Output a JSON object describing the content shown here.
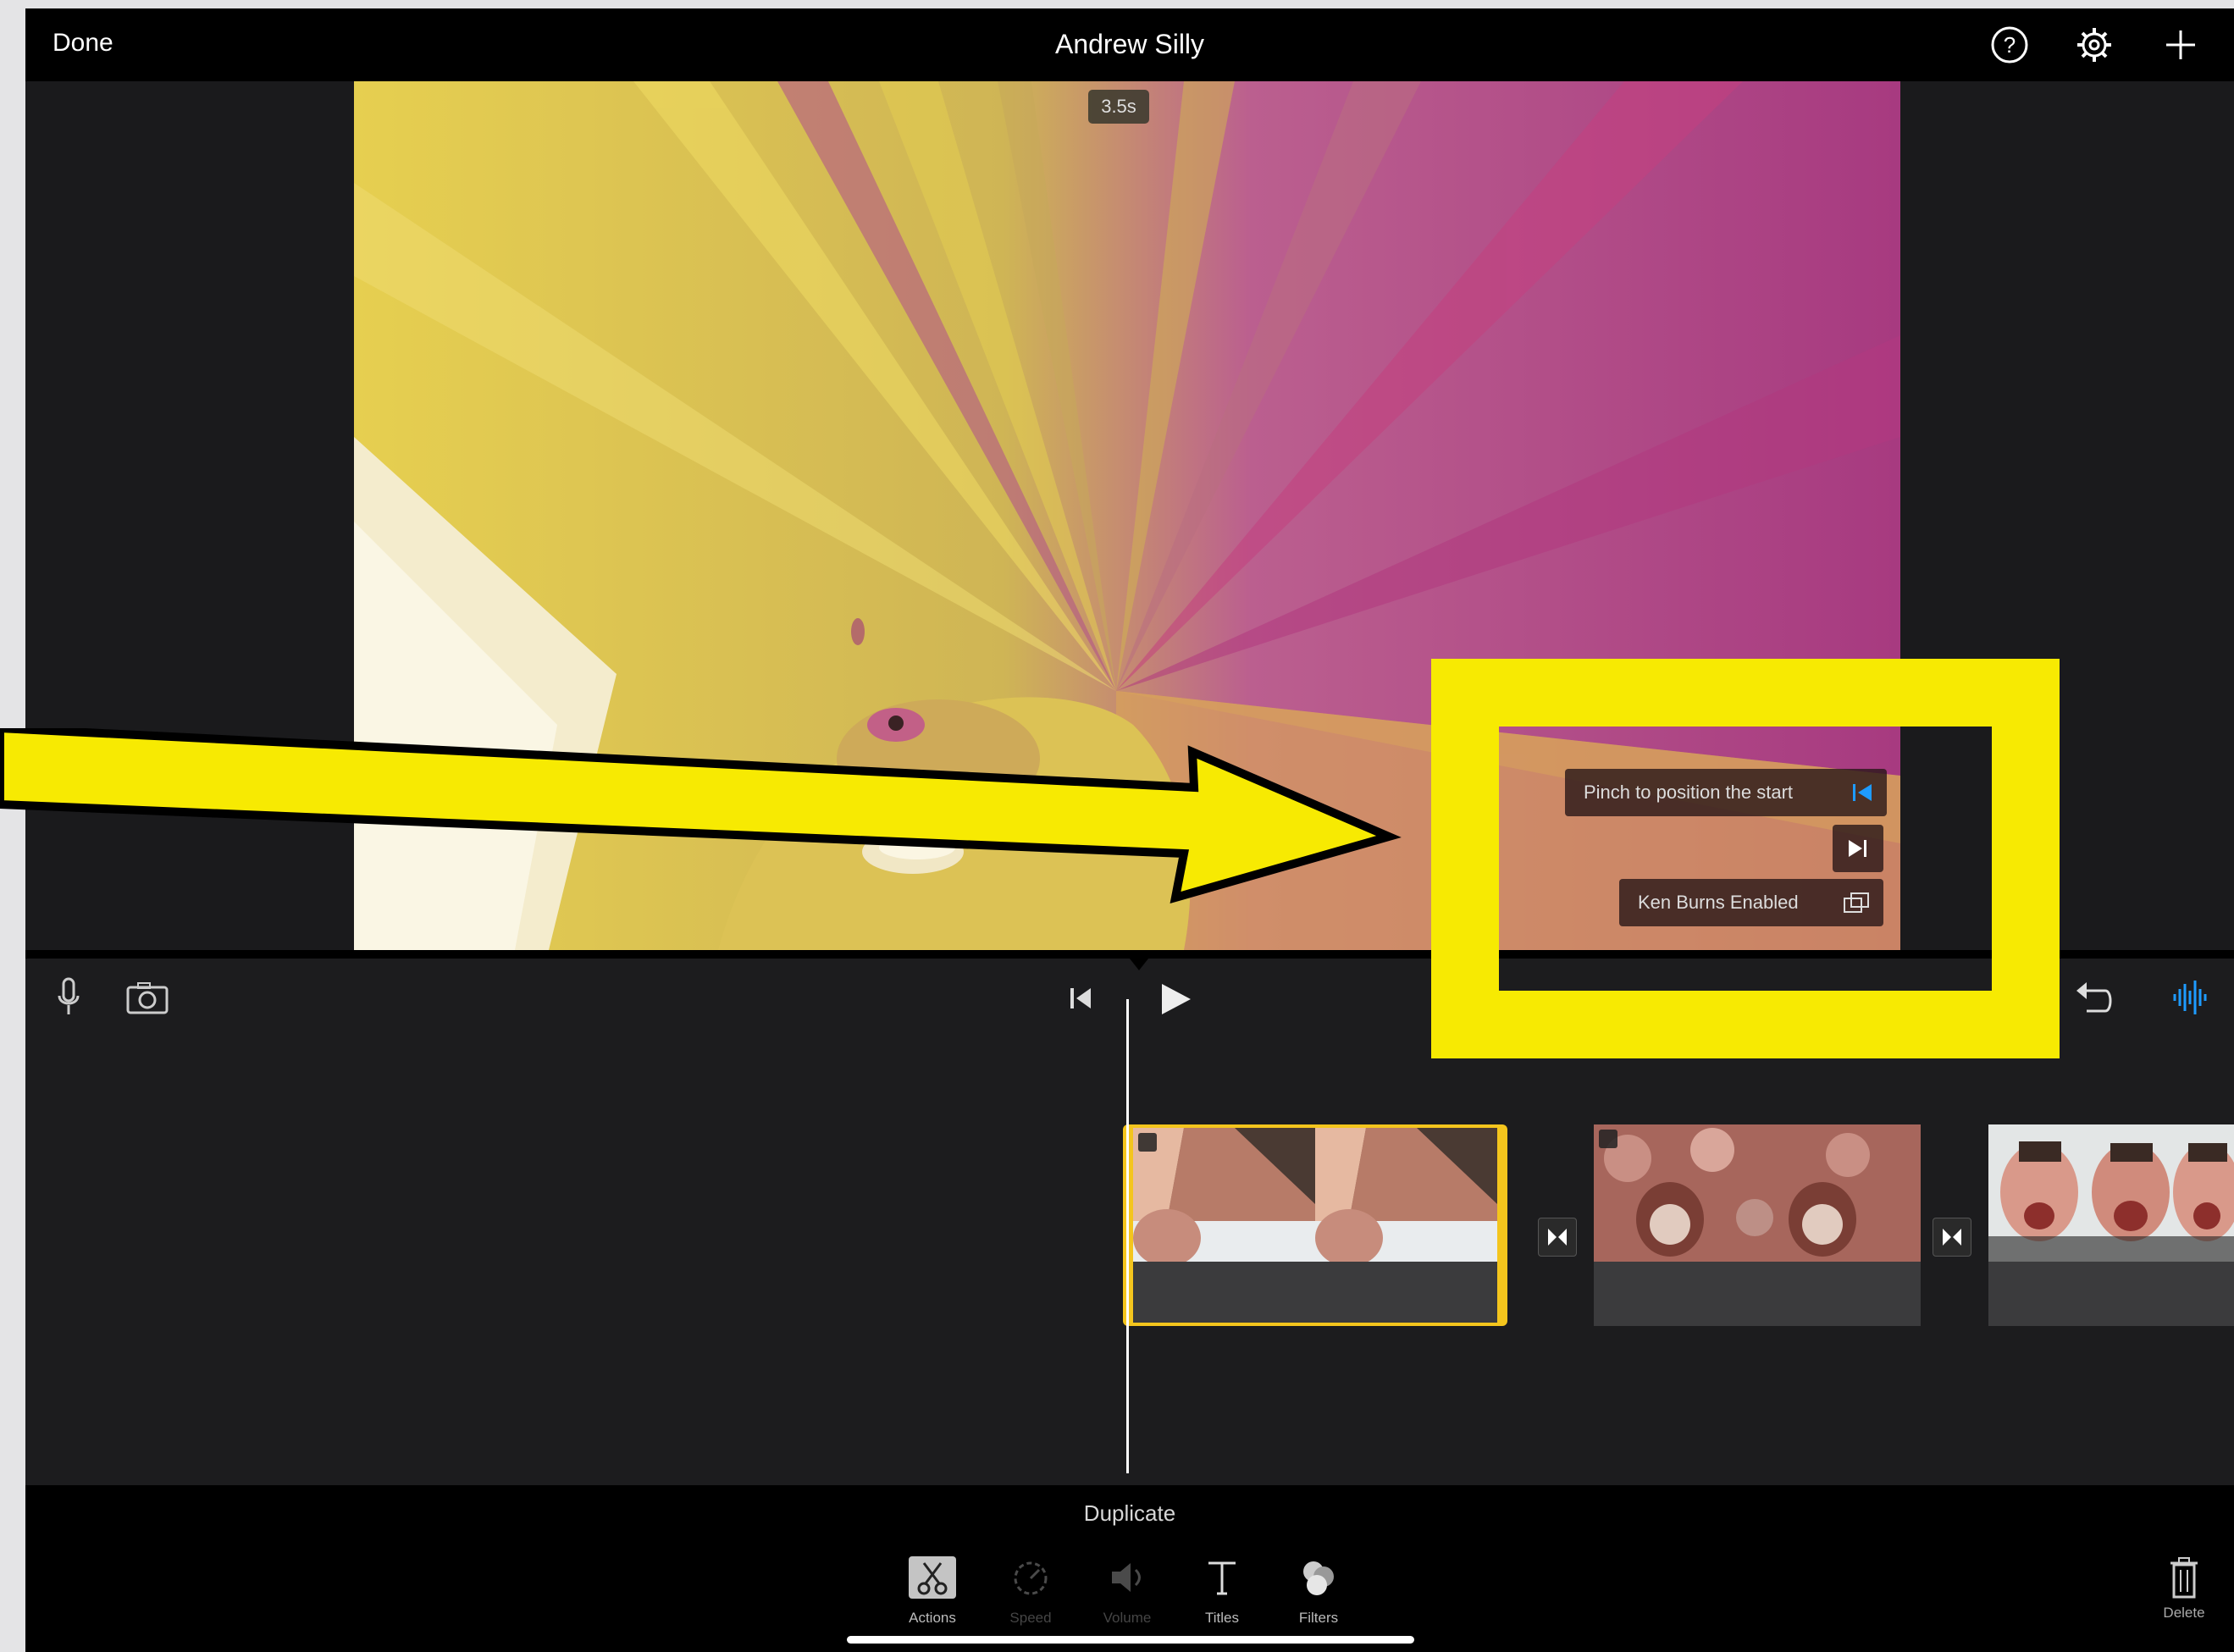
{
  "header": {
    "done_label": "Done",
    "project_title": "Andrew Silly",
    "icons": [
      "help-icon",
      "settings-icon",
      "add-icon"
    ]
  },
  "preview": {
    "duration_badge": "3.5s",
    "ken_burns": {
      "start_hint": "Pinch to position the start",
      "status": "Ken Burns Enabled"
    }
  },
  "timeline": {
    "left_icons": [
      "microphone-icon",
      "camera-icon"
    ],
    "right_icons": [
      "undo-icon",
      "audio-waveform-icon"
    ],
    "clips": [
      {
        "id": "clip-1",
        "selected": true
      },
      {
        "id": "clip-2",
        "selected": false
      },
      {
        "id": "clip-3",
        "selected": false
      }
    ]
  },
  "toolbar": {
    "action_title": "Duplicate",
    "tools": [
      {
        "label": "Actions",
        "icon": "scissors-icon",
        "active": true
      },
      {
        "label": "Speed",
        "icon": "speedometer-icon",
        "active": false
      },
      {
        "label": "Volume",
        "icon": "speaker-icon",
        "active": false
      },
      {
        "label": "Titles",
        "icon": "text-t-icon",
        "active": true
      },
      {
        "label": "Filters",
        "icon": "filters-circles-icon",
        "active": true
      }
    ],
    "delete_label": "Delete"
  },
  "colors": {
    "selection_yellow": "#f4c51d",
    "annotation_yellow": "#f7ea02",
    "accent_blue": "#1e9bff"
  }
}
